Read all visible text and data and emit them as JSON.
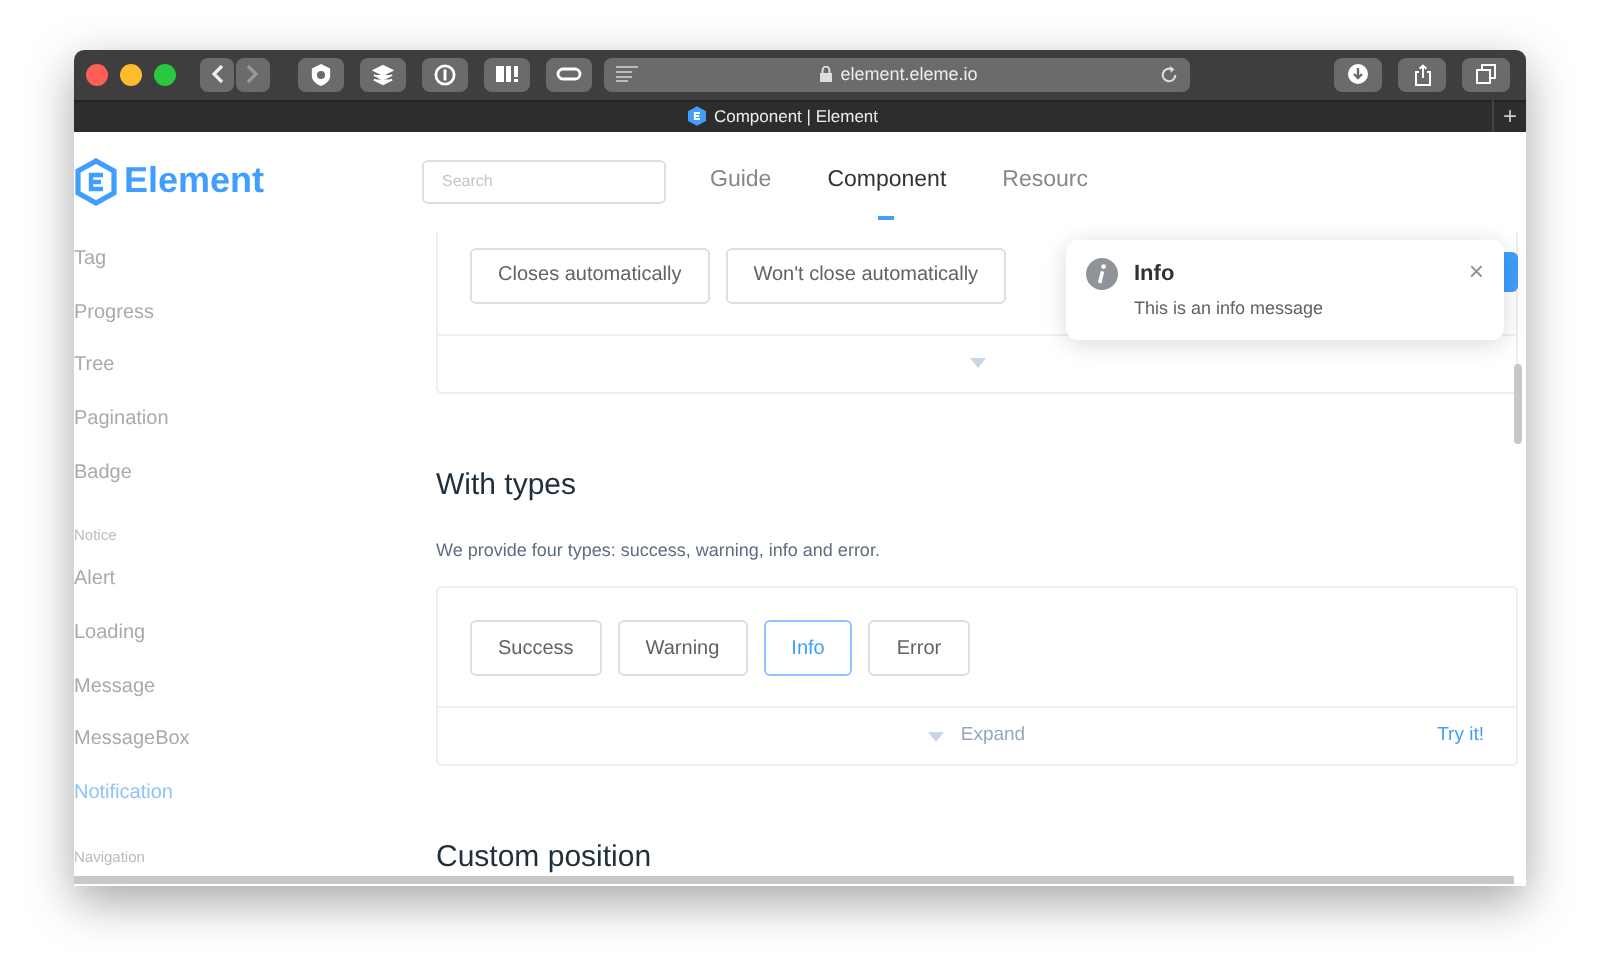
{
  "browser": {
    "url": "element.eleme.io",
    "tab_title": "Component | Element",
    "new_tab": "+"
  },
  "header": {
    "logo": "Element",
    "search": {
      "placeholder": "Search"
    },
    "nav": [
      {
        "label": "Guide",
        "selected": false
      },
      {
        "label": "Component",
        "selected": true
      },
      {
        "label": "Resourc",
        "selected": false
      }
    ]
  },
  "sidebar": {
    "items": [
      {
        "label": "Tag",
        "kind": "item",
        "selected": false
      },
      {
        "label": "Progress",
        "kind": "item",
        "selected": false
      },
      {
        "label": "Tree",
        "kind": "item",
        "selected": false
      },
      {
        "label": "Pagination",
        "kind": "item",
        "selected": false
      },
      {
        "label": "Badge",
        "kind": "item",
        "selected": false
      },
      {
        "label": "Notice",
        "kind": "group"
      },
      {
        "label": "Alert",
        "kind": "item",
        "selected": false
      },
      {
        "label": "Loading",
        "kind": "item",
        "selected": false
      },
      {
        "label": "Message",
        "kind": "item",
        "selected": false
      },
      {
        "label": "MessageBox",
        "kind": "item",
        "selected": false
      },
      {
        "label": "Notification",
        "kind": "item",
        "selected": true
      },
      {
        "label": "Navigation",
        "kind": "group"
      }
    ]
  },
  "demo_1": {
    "buttons": [
      {
        "label": "Closes automatically",
        "selected": false
      },
      {
        "label": "Won't close automatically",
        "selected": false
      }
    ]
  },
  "section": {
    "title": "With types",
    "description": "We provide four types: success, warning, info and error."
  },
  "demo_2": {
    "buttons": [
      {
        "label": "Success",
        "selected": false
      },
      {
        "label": "Warning",
        "selected": false
      },
      {
        "label": "Info",
        "selected": true
      },
      {
        "label": "Error",
        "selected": false
      }
    ],
    "expand": "Expand",
    "try_it": "Try it!"
  },
  "next_section": {
    "title": "Custom position"
  },
  "notification": {
    "title": "Info",
    "message": "This is an info message",
    "close": "×"
  }
}
